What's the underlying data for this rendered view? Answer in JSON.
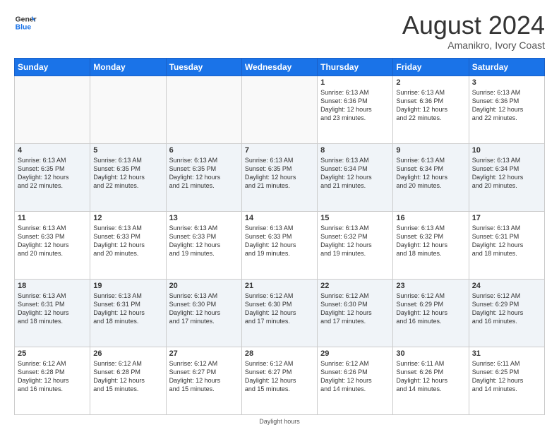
{
  "header": {
    "logo_line1": "General",
    "logo_line2": "Blue",
    "month_title": "August 2024",
    "subtitle": "Amanikro, Ivory Coast"
  },
  "days_of_week": [
    "Sunday",
    "Monday",
    "Tuesday",
    "Wednesday",
    "Thursday",
    "Friday",
    "Saturday"
  ],
  "weeks": [
    [
      {
        "day": "",
        "info": ""
      },
      {
        "day": "",
        "info": ""
      },
      {
        "day": "",
        "info": ""
      },
      {
        "day": "",
        "info": ""
      },
      {
        "day": "1",
        "info": "Sunrise: 6:13 AM\nSunset: 6:36 PM\nDaylight: 12 hours\nand 23 minutes."
      },
      {
        "day": "2",
        "info": "Sunrise: 6:13 AM\nSunset: 6:36 PM\nDaylight: 12 hours\nand 22 minutes."
      },
      {
        "day": "3",
        "info": "Sunrise: 6:13 AM\nSunset: 6:36 PM\nDaylight: 12 hours\nand 22 minutes."
      }
    ],
    [
      {
        "day": "4",
        "info": "Sunrise: 6:13 AM\nSunset: 6:35 PM\nDaylight: 12 hours\nand 22 minutes."
      },
      {
        "day": "5",
        "info": "Sunrise: 6:13 AM\nSunset: 6:35 PM\nDaylight: 12 hours\nand 22 minutes."
      },
      {
        "day": "6",
        "info": "Sunrise: 6:13 AM\nSunset: 6:35 PM\nDaylight: 12 hours\nand 21 minutes."
      },
      {
        "day": "7",
        "info": "Sunrise: 6:13 AM\nSunset: 6:35 PM\nDaylight: 12 hours\nand 21 minutes."
      },
      {
        "day": "8",
        "info": "Sunrise: 6:13 AM\nSunset: 6:34 PM\nDaylight: 12 hours\nand 21 minutes."
      },
      {
        "day": "9",
        "info": "Sunrise: 6:13 AM\nSunset: 6:34 PM\nDaylight: 12 hours\nand 20 minutes."
      },
      {
        "day": "10",
        "info": "Sunrise: 6:13 AM\nSunset: 6:34 PM\nDaylight: 12 hours\nand 20 minutes."
      }
    ],
    [
      {
        "day": "11",
        "info": "Sunrise: 6:13 AM\nSunset: 6:33 PM\nDaylight: 12 hours\nand 20 minutes."
      },
      {
        "day": "12",
        "info": "Sunrise: 6:13 AM\nSunset: 6:33 PM\nDaylight: 12 hours\nand 20 minutes."
      },
      {
        "day": "13",
        "info": "Sunrise: 6:13 AM\nSunset: 6:33 PM\nDaylight: 12 hours\nand 19 minutes."
      },
      {
        "day": "14",
        "info": "Sunrise: 6:13 AM\nSunset: 6:33 PM\nDaylight: 12 hours\nand 19 minutes."
      },
      {
        "day": "15",
        "info": "Sunrise: 6:13 AM\nSunset: 6:32 PM\nDaylight: 12 hours\nand 19 minutes."
      },
      {
        "day": "16",
        "info": "Sunrise: 6:13 AM\nSunset: 6:32 PM\nDaylight: 12 hours\nand 18 minutes."
      },
      {
        "day": "17",
        "info": "Sunrise: 6:13 AM\nSunset: 6:31 PM\nDaylight: 12 hours\nand 18 minutes."
      }
    ],
    [
      {
        "day": "18",
        "info": "Sunrise: 6:13 AM\nSunset: 6:31 PM\nDaylight: 12 hours\nand 18 minutes."
      },
      {
        "day": "19",
        "info": "Sunrise: 6:13 AM\nSunset: 6:31 PM\nDaylight: 12 hours\nand 18 minutes."
      },
      {
        "day": "20",
        "info": "Sunrise: 6:13 AM\nSunset: 6:30 PM\nDaylight: 12 hours\nand 17 minutes."
      },
      {
        "day": "21",
        "info": "Sunrise: 6:12 AM\nSunset: 6:30 PM\nDaylight: 12 hours\nand 17 minutes."
      },
      {
        "day": "22",
        "info": "Sunrise: 6:12 AM\nSunset: 6:30 PM\nDaylight: 12 hours\nand 17 minutes."
      },
      {
        "day": "23",
        "info": "Sunrise: 6:12 AM\nSunset: 6:29 PM\nDaylight: 12 hours\nand 16 minutes."
      },
      {
        "day": "24",
        "info": "Sunrise: 6:12 AM\nSunset: 6:29 PM\nDaylight: 12 hours\nand 16 minutes."
      }
    ],
    [
      {
        "day": "25",
        "info": "Sunrise: 6:12 AM\nSunset: 6:28 PM\nDaylight: 12 hours\nand 16 minutes."
      },
      {
        "day": "26",
        "info": "Sunrise: 6:12 AM\nSunset: 6:28 PM\nDaylight: 12 hours\nand 15 minutes."
      },
      {
        "day": "27",
        "info": "Sunrise: 6:12 AM\nSunset: 6:27 PM\nDaylight: 12 hours\nand 15 minutes."
      },
      {
        "day": "28",
        "info": "Sunrise: 6:12 AM\nSunset: 6:27 PM\nDaylight: 12 hours\nand 15 minutes."
      },
      {
        "day": "29",
        "info": "Sunrise: 6:12 AM\nSunset: 6:26 PM\nDaylight: 12 hours\nand 14 minutes."
      },
      {
        "day": "30",
        "info": "Sunrise: 6:11 AM\nSunset: 6:26 PM\nDaylight: 12 hours\nand 14 minutes."
      },
      {
        "day": "31",
        "info": "Sunrise: 6:11 AM\nSunset: 6:25 PM\nDaylight: 12 hours\nand 14 minutes."
      }
    ]
  ],
  "footer": "Daylight hours"
}
